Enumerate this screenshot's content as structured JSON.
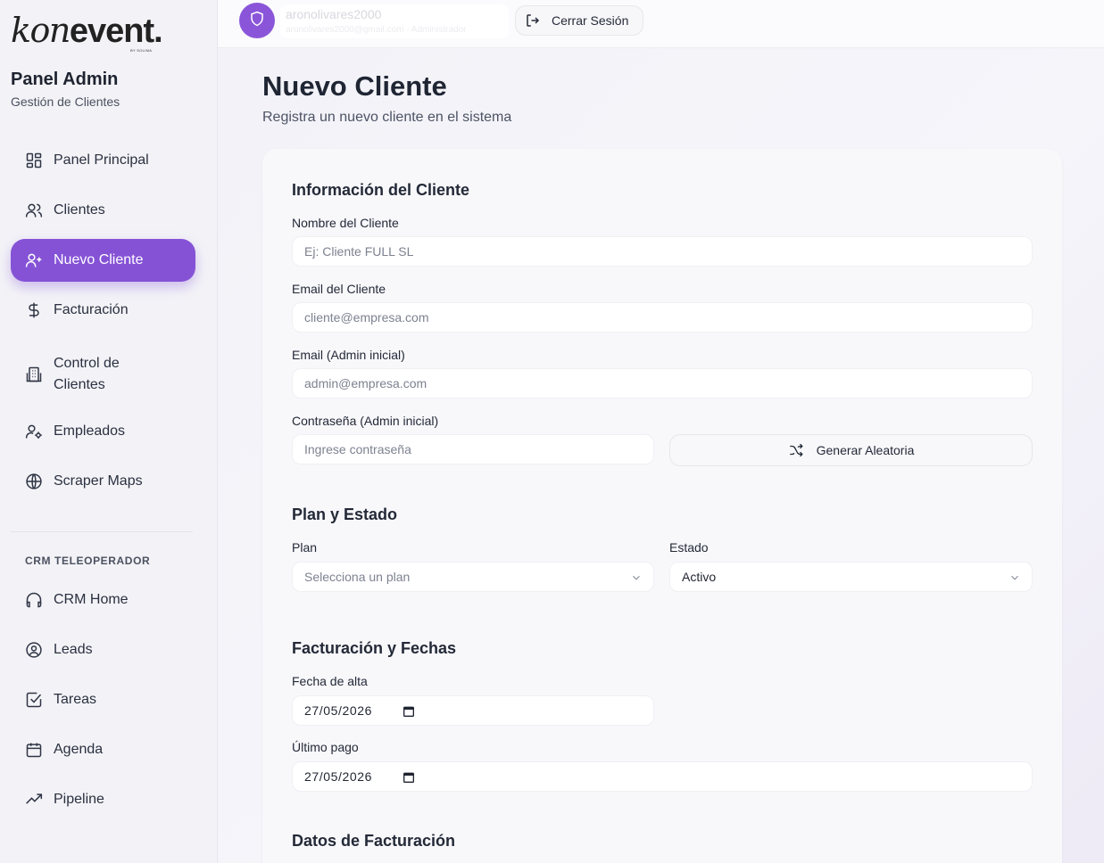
{
  "brand": {
    "logo_kon": "kon",
    "logo_event": "event",
    "logo_dot": ".",
    "logo_sub": "BY SOLIMA"
  },
  "sidebar": {
    "title": "Panel Admin",
    "subtitle": "Gestión de Clientes",
    "items": [
      {
        "label": "Panel Principal",
        "icon": "layout-grid-icon"
      },
      {
        "label": "Clientes",
        "icon": "users-icon"
      },
      {
        "label": "Nuevo Cliente",
        "icon": "user-plus-icon",
        "active": true
      },
      {
        "label": "Facturación",
        "icon": "dollar-icon"
      },
      {
        "label": "Control de Clientes",
        "icon": "building-icon"
      },
      {
        "label": "Empleados",
        "icon": "user-cog-icon"
      },
      {
        "label": "Scraper Maps",
        "icon": "globe-icon"
      }
    ],
    "crm_section_label": "CRM TELEOPERADOR",
    "crm_items": [
      {
        "label": "CRM Home",
        "icon": "headphones-icon"
      },
      {
        "label": "Leads",
        "icon": "user-circle-icon"
      },
      {
        "label": "Tareas",
        "icon": "checkbox-icon"
      },
      {
        "label": "Agenda",
        "icon": "calendar-icon"
      },
      {
        "label": "Pipeline",
        "icon": "trending-up-icon"
      }
    ]
  },
  "topbar": {
    "user_name": "aronolivares2000",
    "user_sub": "aronolivares2000@gmail.com · Administrador",
    "logout_label": "Cerrar Sesión"
  },
  "page": {
    "title": "Nuevo Cliente",
    "subtitle": "Registra un nuevo cliente en el sistema"
  },
  "form": {
    "section_info": "Información del Cliente",
    "name_label": "Nombre del Cliente",
    "name_placeholder": "Ej: Cliente FULL SL",
    "email_label": "Email del Cliente",
    "email_placeholder": "cliente@empresa.com",
    "admin_email_label": "Email (Admin inicial)",
    "admin_email_placeholder": "admin@empresa.com",
    "password_label": "Contraseña (Admin inicial)",
    "password_placeholder": "Ingrese contraseña",
    "generate_label": "Generar Aleatoria",
    "section_plan": "Plan y Estado",
    "plan_label": "Plan",
    "plan_value": "Selecciona un plan",
    "status_label": "Estado",
    "status_value": "Activo",
    "section_billing_dates": "Facturación y Fechas",
    "signup_label": "Fecha de alta",
    "signup_value": "27/05/2026",
    "last_payment_label": "Último pago",
    "last_payment_value": "27/05/2026",
    "section_billing_data": "Datos de Facturación"
  },
  "colors": {
    "accent": "#8552d6",
    "avatar": "#8a55d9"
  }
}
